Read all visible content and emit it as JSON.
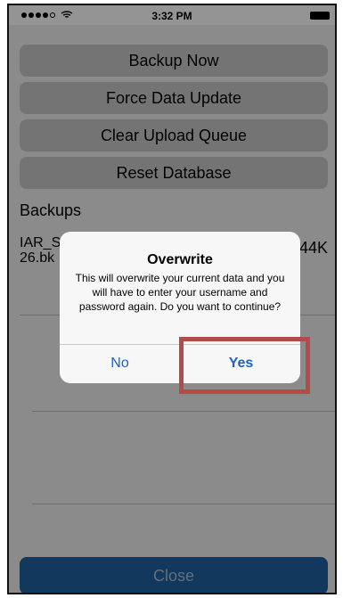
{
  "status_bar": {
    "time": "3:32 PM",
    "signal_icon": "signal-dots-icon",
    "wifi_icon": "wifi-icon",
    "battery_icon": "battery-icon"
  },
  "actions": {
    "backup_now": "Backup Now",
    "force_update": "Force Data Update",
    "clear_queue": "Clear Upload Queue",
    "reset_db": "Reset Database"
  },
  "backups_section": {
    "label": "Backups",
    "items": [
      {
        "name_line1": "IAR_S",
        "name_line2": "26.bk",
        "size": "44K"
      }
    ]
  },
  "close_button": "Close",
  "alert": {
    "title": "Overwrite",
    "message": "This will overwrite your current data and you will have to enter your username and password again. Do you want to continue?",
    "no_label": "No",
    "yes_label": "Yes"
  },
  "colors": {
    "accent": "#1a64c8",
    "close_button_bg": "#1f62a0",
    "highlight_border": "#b54a4a",
    "action_button_bg": "#c9c9c9"
  }
}
